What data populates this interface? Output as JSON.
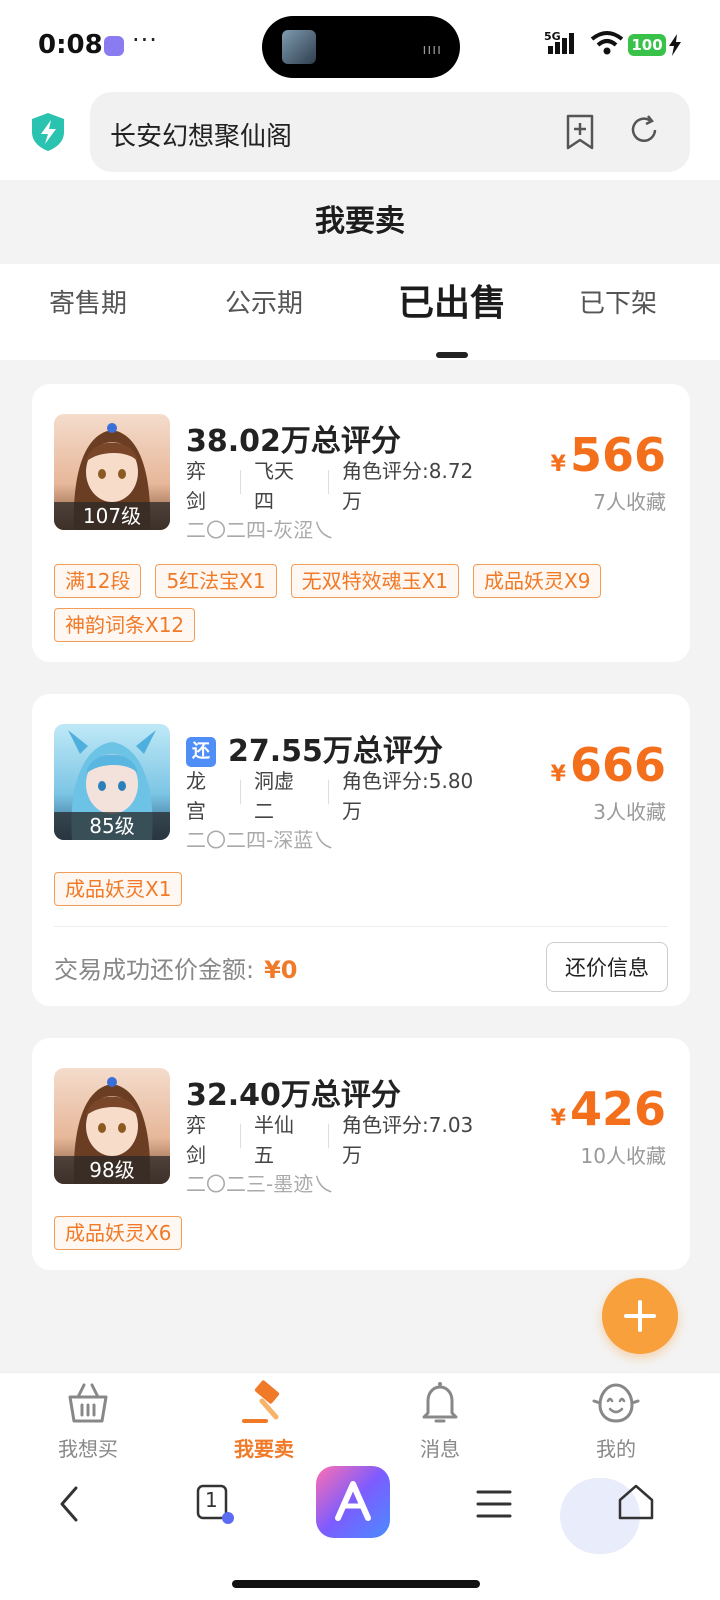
{
  "status": {
    "time": "0:08",
    "network": "5G",
    "battery": "100"
  },
  "address_bar": {
    "url_text": "长安幻想聚仙阁"
  },
  "page": {
    "title": "我要卖"
  },
  "tabs": [
    {
      "label": "寄售期",
      "active": false
    },
    {
      "label": "公示期",
      "active": false
    },
    {
      "label": "已出售",
      "active": true
    },
    {
      "label": "已下架",
      "active": false
    }
  ],
  "listings": [
    {
      "level": "107级",
      "score": "38.02万总评分",
      "bargain_badge": "",
      "school": "弈剑",
      "realm": "飞天四",
      "role_score": "角色评分:8.72万",
      "server": "二〇二四-灰涩乀",
      "price_symbol": "¥",
      "price": "566",
      "favorites": "7人收藏",
      "tags": [
        "满12段",
        "5红法宝X1",
        "无双特效魂玉X1",
        "成品妖灵X9",
        "神韵词条X12"
      ],
      "avatar_theme": "brown-hair"
    },
    {
      "level": "85级",
      "score": "27.55万总评分",
      "bargain_badge": "还",
      "school": "龙宫",
      "realm": "洞虚二",
      "role_score": "角色评分:5.80万",
      "server": "二〇二四-深蓝乀",
      "price_symbol": "¥",
      "price": "666",
      "favorites": "3人收藏",
      "tags": [
        "成品妖灵X1"
      ],
      "bargain_amount_label": "交易成功还价金额:",
      "bargain_amount": "¥0",
      "bargain_button": "还价信息",
      "avatar_theme": "blue-dragon"
    },
    {
      "level": "98级",
      "score": "32.40万总评分",
      "bargain_badge": "",
      "school": "弈剑",
      "realm": "半仙五",
      "role_score": "角色评分:7.03万",
      "server": "二〇二三-墨迹乀",
      "price_symbol": "¥",
      "price": "426",
      "favorites": "10人收藏",
      "tags": [
        "成品妖灵X6"
      ],
      "avatar_theme": "brown-hair"
    }
  ],
  "bottom_nav": [
    {
      "label": "我想买",
      "icon": "basket-icon",
      "active": false
    },
    {
      "label": "我要卖",
      "icon": "auction-hammer-icon",
      "active": true
    },
    {
      "label": "消息",
      "icon": "bell-icon",
      "active": false
    },
    {
      "label": "我的",
      "icon": "mascot-face-icon",
      "active": false
    }
  ],
  "browser_bar": {
    "tab_count": "1"
  },
  "colors": {
    "accent": "#f07a28",
    "fab": "#f7a03c",
    "badge_blue": "#4f8ef7"
  }
}
